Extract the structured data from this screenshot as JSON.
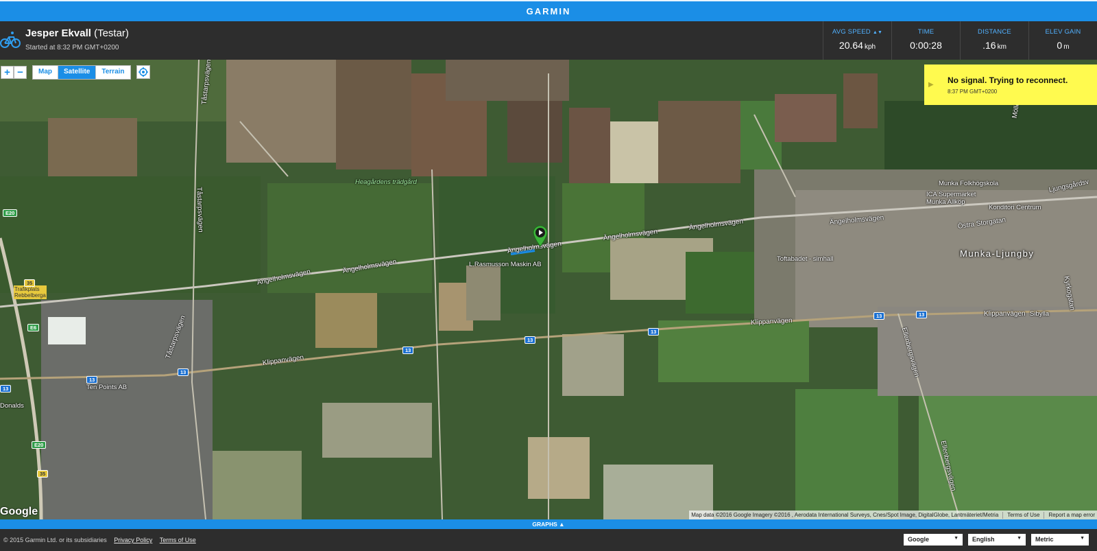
{
  "topbar": {
    "brand": "GARMIN"
  },
  "activity": {
    "athlete_name": "Jesper Ekvall",
    "athlete_role": "(Testar)",
    "started": "Started at 8:32 PM GMT+0200"
  },
  "stats": [
    {
      "label": "AVG SPEED",
      "value": "20.64",
      "unit": "kph",
      "sortable": true
    },
    {
      "label": "TIME",
      "value": "0:00:28",
      "unit": ""
    },
    {
      "label": "DISTANCE",
      "value": ".16",
      "unit": "km"
    },
    {
      "label": "ELEV GAIN",
      "value": "0",
      "unit": "m"
    }
  ],
  "map_controls": {
    "zoom_in": "+",
    "zoom_out": "−",
    "types": [
      "Map",
      "Satellite",
      "Terrain"
    ],
    "active_type": "Satellite"
  },
  "notification": {
    "message": "No signal. Trying to reconnect.",
    "time": "8:37 PM GMT+0200"
  },
  "map_labels": {
    "roads": [
      "Tåstarpsvägen",
      "Tåstarpsvägen",
      "Ängelholmsvägen",
      "Ängelholmsvägen",
      "Ängelholmsvägen",
      "Ängelholmsvägen",
      "Ängelholmsvägen",
      "Ängelholmsvägen",
      "Klippanvägen",
      "Klippanvägen",
      "Klippanvägen",
      "Tåstarpsvägen",
      "Ellenbergsvägen",
      "Ellenbergsvägen",
      "Östra Storgatan",
      "Ljungsgårdsv",
      "Kyrkogatan",
      "Möllegar"
    ],
    "pois": [
      "Heagårdens trädgård",
      "L.Rasmusson Maskin AB",
      "Ten Points AB",
      "Toftabadet - simhall",
      "Munka Folkhögskola",
      "ICA Supermarket Munka Allköp",
      "Konditori Centrum",
      "Sibylla",
      "Trafikplats Rebbelberga",
      "Donalds"
    ],
    "town": "Munka-Ljungby",
    "shields": [
      "E20",
      "35",
      "E6",
      "13",
      "13",
      "13",
      "13",
      "13",
      "13",
      "13",
      "13",
      "E20",
      "35"
    ]
  },
  "attribution": {
    "google": "Google",
    "map_data": "Map data ©2016 Google Imagery ©2016 , Aerodata International Surveys, Cnes/Spot Image, DigitalGlobe, Lantmäteriet/Metria",
    "terms": "Terms of Use",
    "report": "Report a map error"
  },
  "graphs_bar": {
    "label": "GRAPHS ▲"
  },
  "footer": {
    "copyright": "© 2015 Garmin Ltd. or its subsidiaries",
    "privacy": "Privacy Policy",
    "terms": "Terms of Use",
    "selects": [
      {
        "value": "Google"
      },
      {
        "value": "English"
      },
      {
        "value": "Metric"
      }
    ]
  },
  "colors": {
    "brand_blue": "#1b8ee6",
    "header_bg": "#2d2d2d",
    "toast_yellow": "#fffa4f",
    "marker_green": "#3db33a"
  }
}
